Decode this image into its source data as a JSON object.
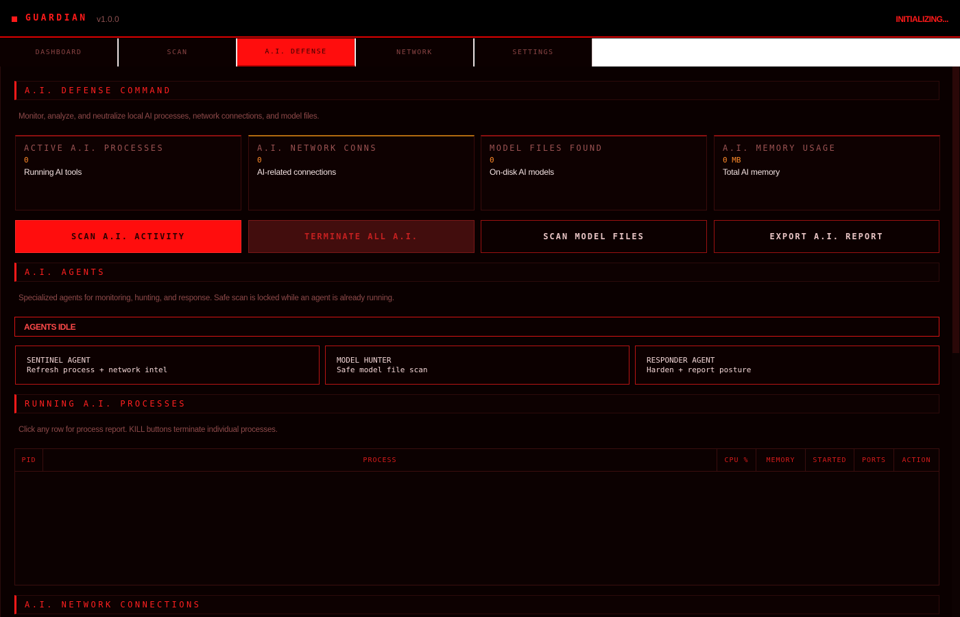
{
  "app": {
    "name": "GUARDIAN",
    "version": "v1.0.0",
    "status": "INITIALIZING..."
  },
  "tabs": [
    {
      "label": "DASHBOARD",
      "active": false
    },
    {
      "label": "SCAN",
      "active": false
    },
    {
      "label": "A.I. DEFENSE",
      "active": true
    },
    {
      "label": "NETWORK",
      "active": false
    },
    {
      "label": "SETTINGS",
      "active": false
    }
  ],
  "defense": {
    "title": "A.I. DEFENSE COMMAND",
    "description": "Monitor, analyze, and neutralize local AI processes, network connections, and model files."
  },
  "stats": [
    {
      "title": "ACTIVE A.I. PROCESSES",
      "value": "0",
      "sub": "Running AI tools"
    },
    {
      "title": "A.I. NETWORK CONNS",
      "value": "0",
      "sub": "AI-related connections"
    },
    {
      "title": "MODEL FILES FOUND",
      "value": "0",
      "sub": "On-disk AI models"
    },
    {
      "title": "A.I. MEMORY USAGE",
      "value": "0 MB",
      "sub": "Total AI memory"
    }
  ],
  "actions": {
    "scan": "SCAN A.I. ACTIVITY",
    "terminate": "TERMINATE ALL A.I.",
    "scan_models": "SCAN MODEL FILES",
    "export": "EXPORT A.I. REPORT"
  },
  "agents": {
    "title": "A.I. AGENTS",
    "description": "Specialized agents for monitoring, hunting, and response. Safe scan is locked while an agent is already running.",
    "status": "AGENTS IDLE",
    "items": [
      {
        "title": "SENTINEL AGENT",
        "sub": "Refresh process + network intel"
      },
      {
        "title": "MODEL HUNTER",
        "sub": "Safe model file scan"
      },
      {
        "title": "RESPONDER AGENT",
        "sub": "Harden + report posture"
      }
    ]
  },
  "processes": {
    "title": "RUNNING A.I. PROCESSES",
    "description": "Click any row for process report. KILL buttons terminate individual processes.",
    "columns": [
      "PID",
      "PROCESS",
      "CPU %",
      "MEMORY",
      "STARTED",
      "PORTS",
      "ACTION"
    ]
  },
  "connections": {
    "title": "A.I. NETWORK CONNECTIONS"
  },
  "colors": {
    "accent": "#ff1a1a",
    "background": "#0a0000",
    "amber": "#ff8a2a"
  }
}
